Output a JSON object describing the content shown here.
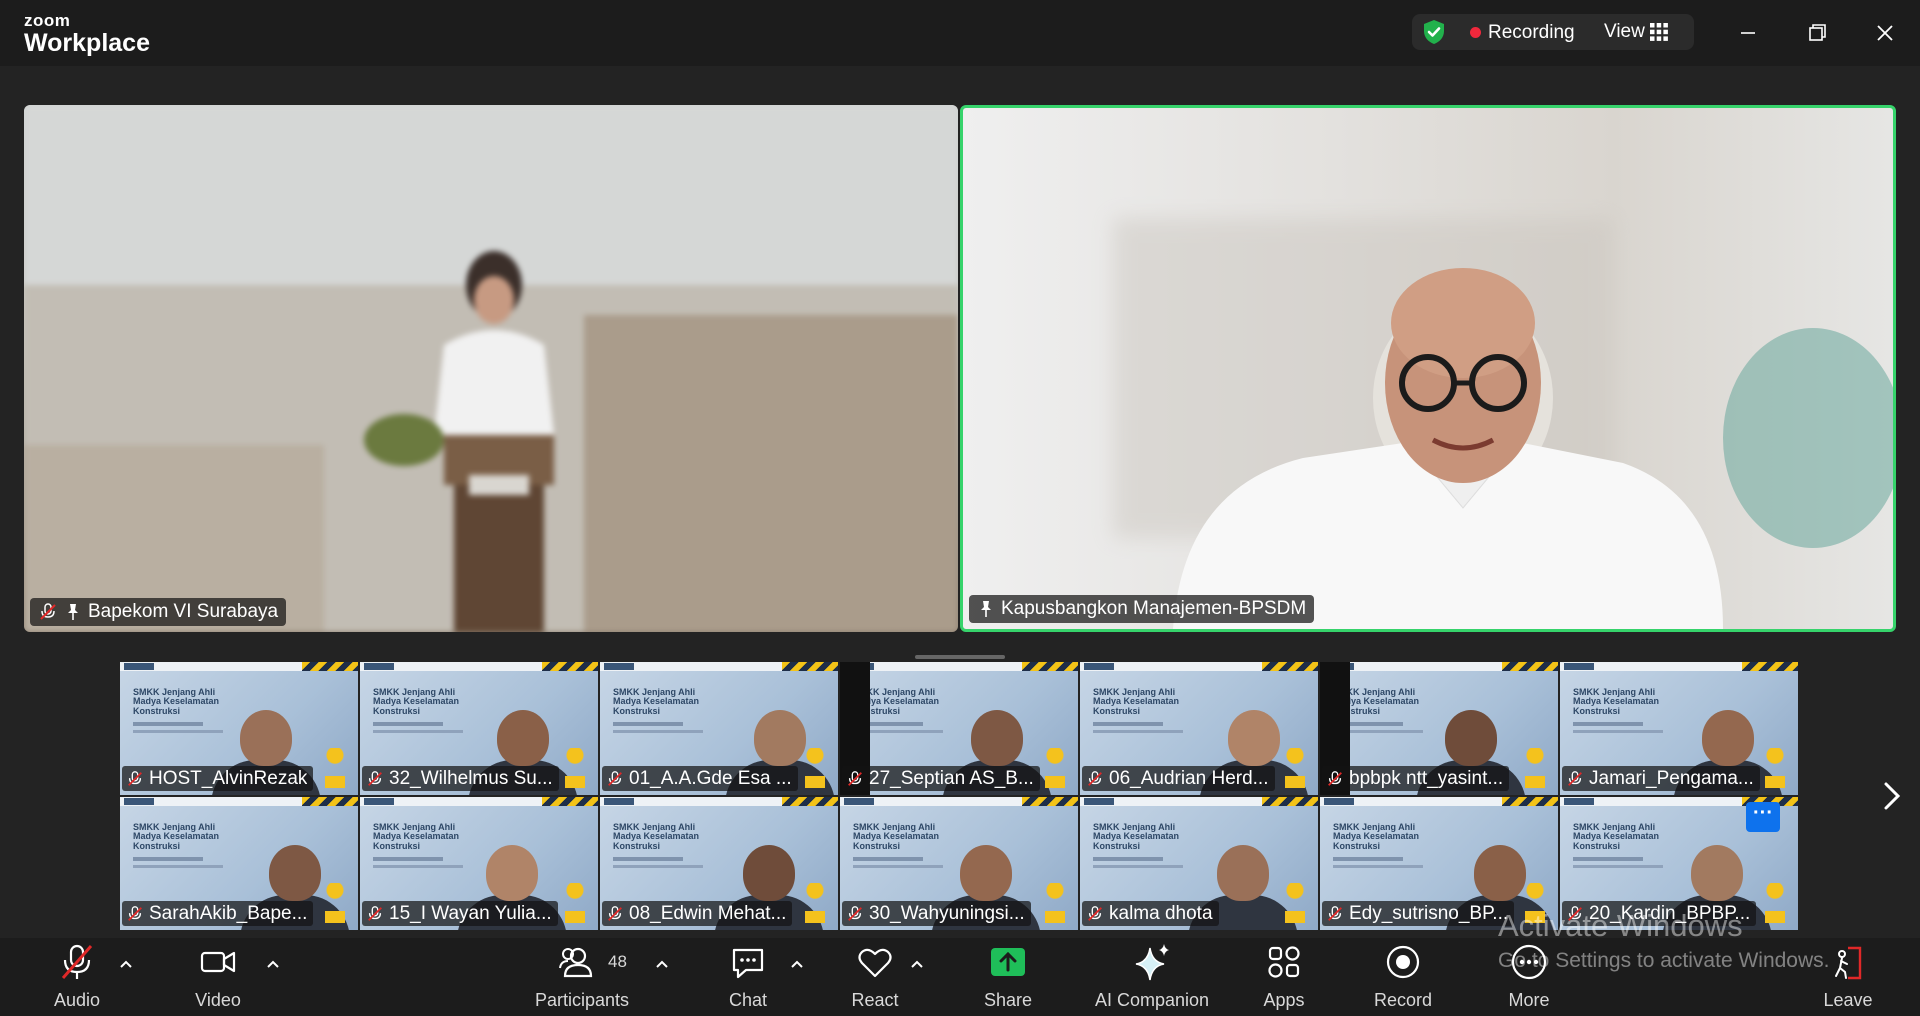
{
  "titlebar": {
    "brand_small": "zoom",
    "brand_large": "Workplace",
    "recording_label": "Recording",
    "view_label": "View"
  },
  "videos": {
    "left_name": "Bapekom VI Surabaya",
    "right_name": "Kapusbangkon Manajemen-BPSDM"
  },
  "slide": {
    "title_l1": "SMKK Jenjang Ahli",
    "title_l2": "Madya Keselamatan",
    "title_l3": "Konstruksi"
  },
  "participants_row1": [
    "HOST_AlvinRezak",
    "32_Wilhelmus Su...",
    "01_A.A.Gde Esa ...",
    "27_Septian AS_B...",
    "06_Audrian Herd...",
    "bpbpk ntt_yasint...",
    "Jamari_Pengama..."
  ],
  "participants_row2": [
    "SarahAkib_Bape...",
    "15_I Wayan Yulia...",
    "08_Edwin Mehat...",
    "30_Wahyuningsi...",
    "kalma dhota",
    "Edy_sutrisno_BP...",
    "20_Kardin_BPBP..."
  ],
  "toolbar": {
    "audio": "Audio",
    "video": "Video",
    "participants": "Participants",
    "participants_count": "48",
    "chat": "Chat",
    "react": "React",
    "share": "Share",
    "ai_companion": "AI Companion",
    "apps": "Apps",
    "record": "Record",
    "more": "More",
    "leave": "Leave"
  },
  "watermark": {
    "line1": "Activate Windows",
    "line2": "Go to Settings to activate Windows."
  },
  "colors": {
    "active_speaker_border": "#36d36b",
    "recording_dot": "#f0283c",
    "share_button": "#1fbe59",
    "leave_red": "#e02828",
    "shield_green": "#22b14c"
  }
}
